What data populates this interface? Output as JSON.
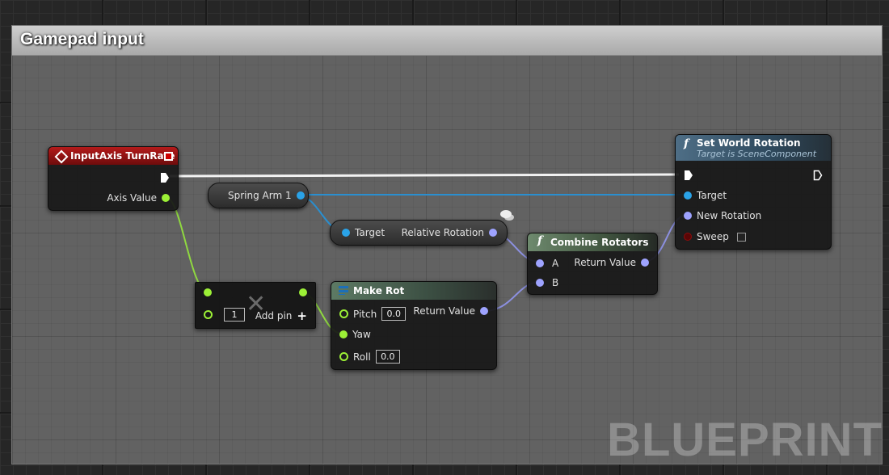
{
  "comment": {
    "title": "Gamepad input"
  },
  "input_axis": {
    "title": "InputAxis TurnRate",
    "pin_axis_value": "Axis Value"
  },
  "spring_arm": {
    "label": "Spring Arm 1"
  },
  "get_rel_rot": {
    "pin_target": "Target",
    "pin_out": "Relative Rotation"
  },
  "multiply": {
    "value": "1",
    "add_pin": "Add pin"
  },
  "make_rot": {
    "title": "Make Rot",
    "pitch": "Pitch",
    "pitch_value": "0.0",
    "yaw": "Yaw",
    "roll": "Roll",
    "roll_value": "0.0",
    "return_value": "Return Value"
  },
  "combine": {
    "title": "Combine Rotators",
    "a": "A",
    "b": "B",
    "return_value": "Return Value"
  },
  "set_world_rot": {
    "title": "Set World Rotation",
    "subtitle": "Target is SceneComponent",
    "target": "Target",
    "new_rotation": "New Rotation",
    "sweep": "Sweep"
  },
  "watermark": "BLUEPRINT",
  "colors": {
    "float_pin": "#9cf036",
    "object_pin": "#2aa3e8",
    "rotator_pin": "#9ea3ff",
    "bool_pin": "#8e0b0b",
    "event_header": "#a31414",
    "function_header": "#6e8a6e"
  }
}
